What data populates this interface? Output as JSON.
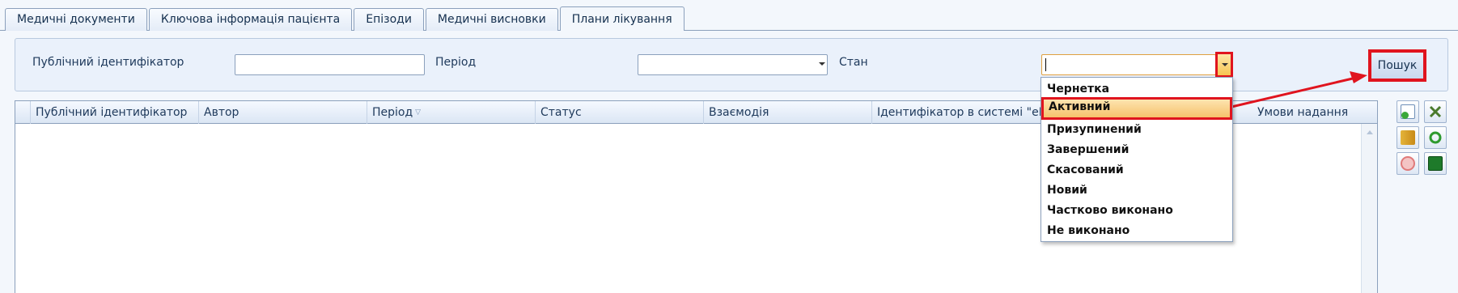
{
  "tabs": [
    {
      "label": "Медичні документи"
    },
    {
      "label": "Ключова інформація пацієнта"
    },
    {
      "label": "Епізоди"
    },
    {
      "label": "Медичні висновки"
    },
    {
      "label": "Плани лікування"
    }
  ],
  "filters": {
    "public_id_label": "Публічний ідентифікатор",
    "public_id_value": "",
    "period_label": "Період",
    "period_value": "",
    "status_label": "Стан",
    "status_value": "",
    "search_label": "Пошук"
  },
  "grid": {
    "columns": [
      "Публічний ідентифікатор",
      "Автор",
      "Період",
      "Статус",
      "Взаємодія",
      "Ідентифікатор в системі \"eHealth\"",
      "Умови надання"
    ],
    "rows": []
  },
  "status_dropdown": {
    "options": [
      "Чернетка",
      "Активний",
      "Призупинений",
      "Завершений",
      "Скасований",
      "Новий",
      "Частково виконано",
      "Не виконано"
    ],
    "highlighted": "Активний"
  },
  "toolbar": {
    "buttons": [
      "add-document-icon",
      "tools-icon",
      "book-icon",
      "refresh-icon",
      "cancel-icon",
      "table-icon"
    ]
  },
  "colors": {
    "annotation_red": "#e0141e",
    "highlight": "#f6c26c",
    "border": "#8ba0bc"
  }
}
